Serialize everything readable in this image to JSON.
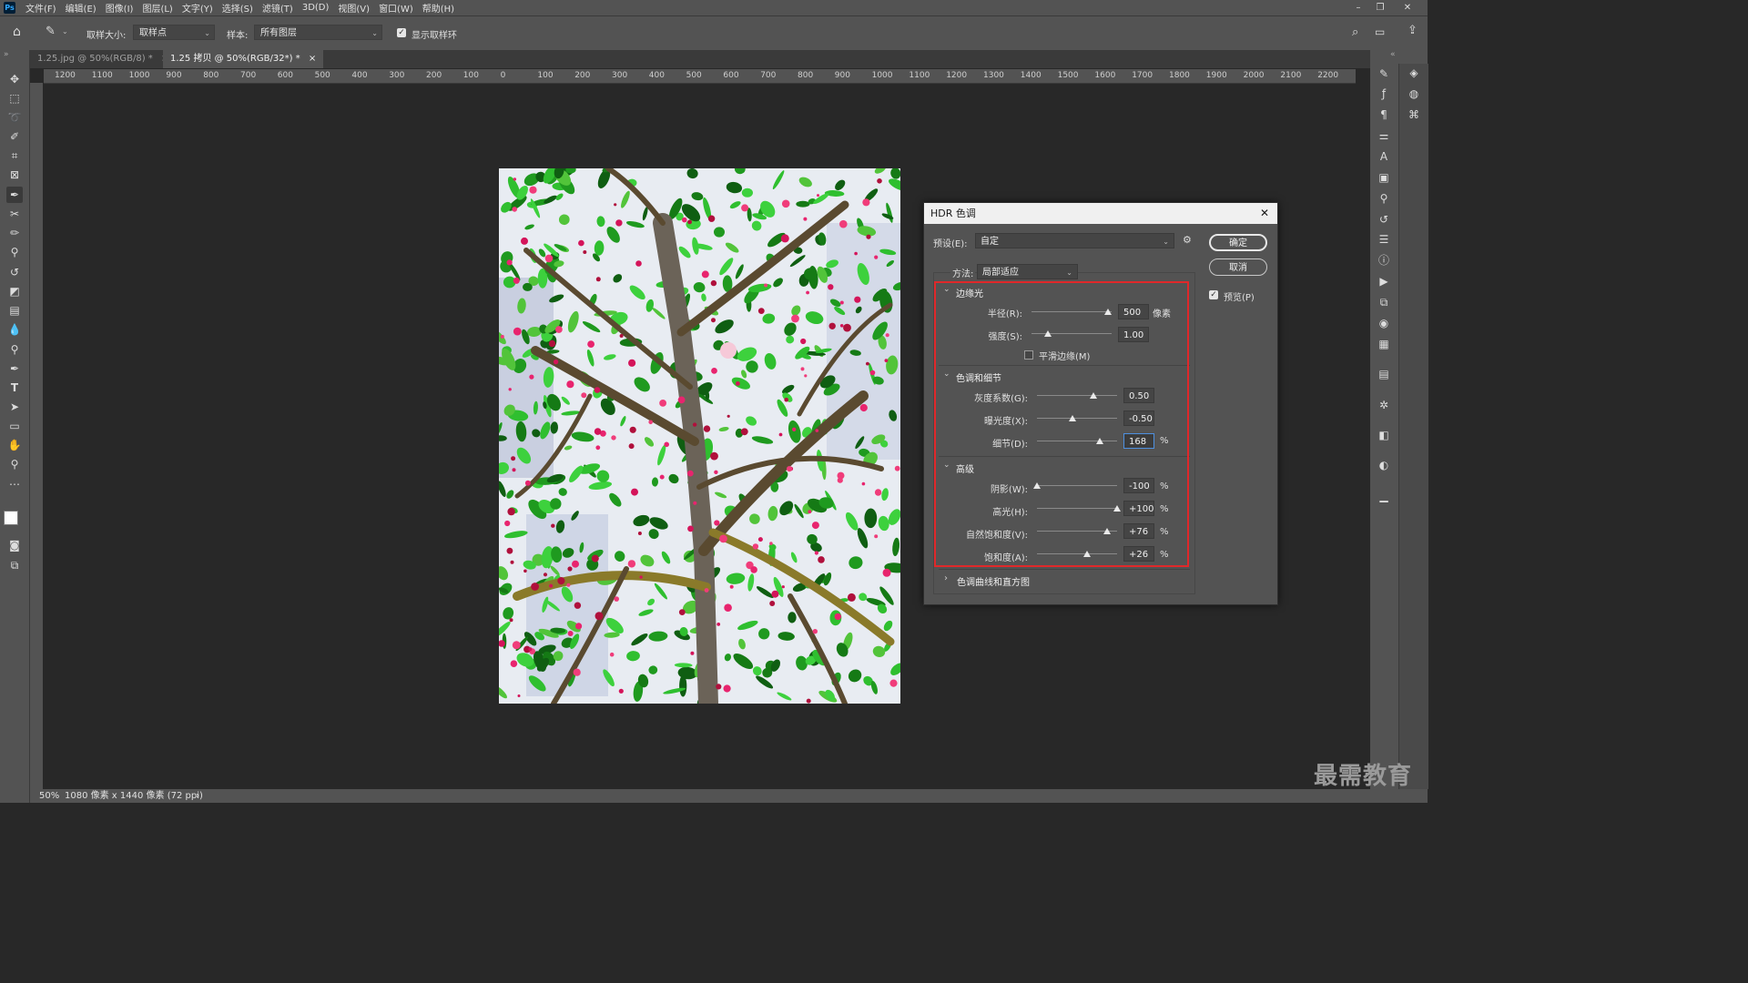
{
  "menubar": {
    "logo": "Ps",
    "items": [
      "文件(F)",
      "编辑(E)",
      "图像(I)",
      "图层(L)",
      "文字(Y)",
      "选择(S)",
      "滤镜(T)",
      "3D(D)",
      "视图(V)",
      "窗口(W)",
      "帮助(H)"
    ],
    "window_controls": [
      "minimize-icon",
      "restore-icon",
      "close-icon"
    ]
  },
  "options": {
    "sample_size_label": "取样大小:",
    "sample_size_value": "取样点",
    "sample_label": "样本:",
    "sample_value": "所有图层",
    "show_ring_label": "显示取样环",
    "show_ring_checked": true
  },
  "tabs": [
    {
      "label": "1.25.jpg @ 50%(RGB/8) *",
      "close": "×",
      "active": false
    },
    {
      "label": "1.25 拷贝 @ 50%(RGB/32*) *",
      "close": "×",
      "active": true
    }
  ],
  "ruler": {
    "h_ticks": [
      "1200",
      "1100",
      "1000",
      "900",
      "800",
      "700",
      "600",
      "500",
      "400",
      "300",
      "200",
      "100",
      "0",
      "100",
      "200",
      "300",
      "400",
      "500",
      "600",
      "700",
      "800",
      "900",
      "1000",
      "1100",
      "1200",
      "1300",
      "1400",
      "1500",
      "1600",
      "1700",
      "1800",
      "1900",
      "2000",
      "2100",
      "2200"
    ]
  },
  "dialog": {
    "title": "HDR 色调",
    "close": "✕",
    "preset_label": "预设(E):",
    "preset_value": "自定",
    "method_label": "方法:",
    "method_value": "局部适应",
    "ok_label": "确定",
    "cancel_label": "取消",
    "preview_label": "预览(P)",
    "preview_checked": true,
    "edge_glow": {
      "title": "边缘光",
      "radius_label": "半径(R):",
      "radius_value": "500",
      "radius_unit": "像素",
      "radius_level": 0.96,
      "strength_label": "强度(S):",
      "strength_value": "1.00",
      "strength_level": 0.2,
      "smooth_label": "平滑边缘(M)",
      "smooth_checked": false
    },
    "tone_detail": {
      "title": "色调和细节",
      "gamma_label": "灰度系数(G):",
      "gamma_value": "0.50",
      "gamma_level": 0.71,
      "exposure_label": "曝光度(X):",
      "exposure_value": "-0.50",
      "exposure_level": 0.44,
      "detail_label": "细节(D):",
      "detail_value": "168",
      "detail_unit": "%",
      "detail_level": 0.78
    },
    "advanced": {
      "title": "高级",
      "shadow_label": "阴影(W):",
      "shadow_value": "-100",
      "shadow_level": 0.0,
      "highlight_label": "高光(H):",
      "highlight_value": "+100",
      "highlight_level": 1.0,
      "vibrance_label": "自然饱和度(V):",
      "vibrance_value": "+76",
      "vibrance_level": 0.88,
      "saturation_label": "饱和度(A):",
      "saturation_value": "+26",
      "saturation_level": 0.63,
      "unit": "%"
    },
    "curve_section": "色调曲线和直方图"
  },
  "status": {
    "zoom": "50%",
    "info": "1080 像素 x 1440 像素 (72 ppi)",
    "arrow": "›"
  },
  "watermark": "最需教育"
}
